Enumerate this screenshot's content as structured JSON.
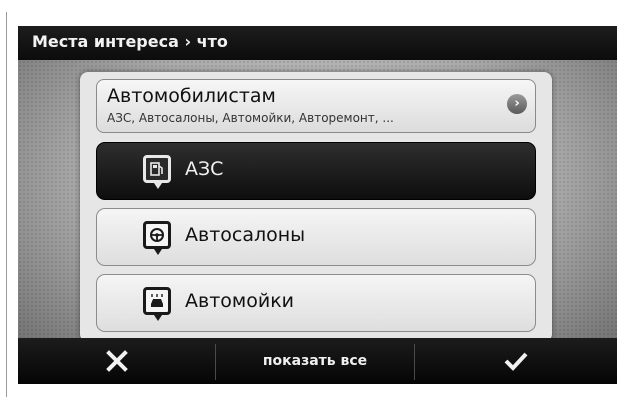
{
  "title": "Места интереса › что",
  "category": {
    "title": "Автомобилистам",
    "subtitle": "АЗС, Автосалоны, Автомойки, Авторемонт, ...",
    "arrow": "›"
  },
  "items": [
    {
      "label": "АЗС",
      "icon": "fuel-pump-icon",
      "selected": true
    },
    {
      "label": "Автосалоны",
      "icon": "steering-wheel-icon",
      "selected": false
    },
    {
      "label": "Автомойки",
      "icon": "car-wash-icon",
      "selected": false
    }
  ],
  "bottom": {
    "cancel_icon": "close-icon",
    "show_all_label": "показать все",
    "ok_icon": "checkmark-icon"
  }
}
